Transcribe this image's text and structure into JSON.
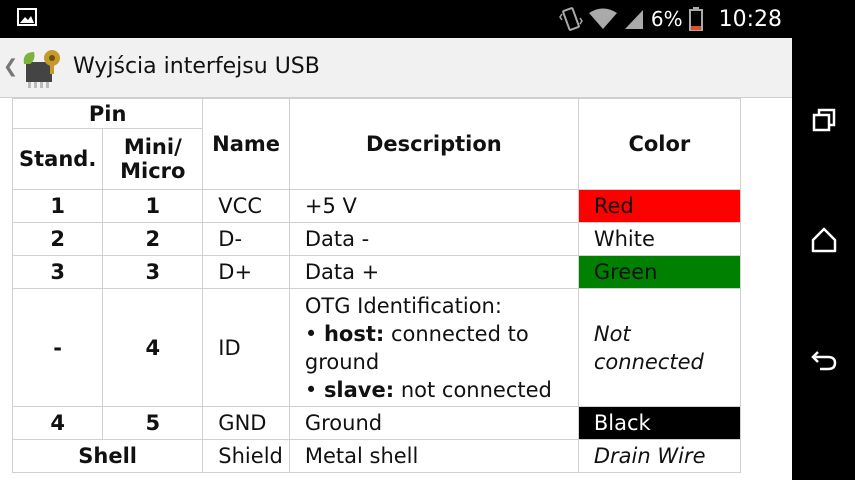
{
  "status_bar": {
    "battery_pct": "6%",
    "time": "10:28",
    "icons": [
      "image-notification-icon",
      "vibrate-icon",
      "wifi-icon",
      "signal-icon",
      "battery-icon"
    ]
  },
  "action_bar": {
    "title": "Wyjścia interfejsu USB",
    "back_glyph": "❮"
  },
  "table": {
    "header": {
      "pin": "Pin",
      "stand": "Stand.",
      "mini_micro_line1": "Mini/",
      "mini_micro_line2": "Micro",
      "name": "Name",
      "description": "Description",
      "color": "Color"
    },
    "rows": [
      {
        "stand": "1",
        "mini": "1",
        "name": "VCC",
        "desc": "+5 V",
        "color": "Red",
        "swatch": "#ff0000"
      },
      {
        "stand": "2",
        "mini": "2",
        "name": "D-",
        "desc": "Data -",
        "color": "White",
        "swatch": "#ffffff"
      },
      {
        "stand": "3",
        "mini": "3",
        "name": "D+",
        "desc": "Data +",
        "color": "Green",
        "swatch": "#008000"
      },
      {
        "stand": "-",
        "mini": "4",
        "name": "ID",
        "desc_line1": "OTG Identification:",
        "desc_host_bullet": "•",
        "desc_host_label": "host:",
        "desc_host_text": "connected to ground",
        "desc_slave_bullet": "•",
        "desc_slave_label": "slave:",
        "desc_slave_text": "not connected",
        "color": "Not connected"
      },
      {
        "stand": "4",
        "mini": "5",
        "name": "GND",
        "desc": "Ground",
        "color": "Black",
        "swatch": "#000000"
      },
      {
        "stand_mini": "Shell",
        "name": "Shield",
        "desc": "Metal shell",
        "color": "Drain Wire"
      }
    ]
  }
}
